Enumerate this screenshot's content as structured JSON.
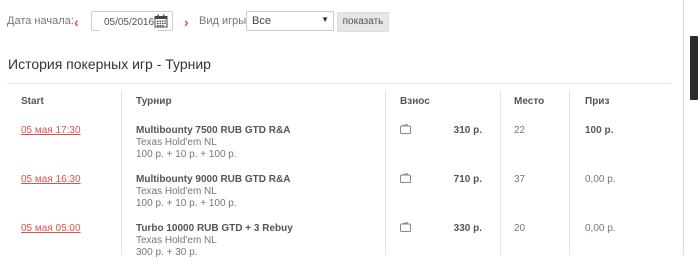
{
  "filters": {
    "start_date_label": "Дата начала:",
    "prev_symbol": "‹",
    "next_symbol": "›",
    "date_value": "05/05/2016",
    "game_type_label": "Вид игры:",
    "game_type_selected": "Все",
    "show_button": "показать"
  },
  "page": {
    "title": "История покерных игр - Турнир"
  },
  "table": {
    "headers": {
      "start": "Start",
      "tournament": "Турнир",
      "buyin": "Взнос",
      "place": "Место",
      "prize": "Приз"
    },
    "rows": [
      {
        "date": "05 мая 17:30",
        "name": "Multibounty 7500 RUB GTD R&A",
        "game": "Texas Hold'em NL",
        "fees": "100 р. + 10 р. + 100 р.",
        "buyin": "310 р.",
        "place": "22",
        "prize": "100 р."
      },
      {
        "date": "05 мая 16:30",
        "name": "Multibounty 9000 RUB GTD R&A",
        "game": "Texas Hold'em NL",
        "fees": "100 р. + 10 р. + 100 р.",
        "buyin": "710 р.",
        "place": "37",
        "prize": "0,00 р."
      },
      {
        "date": "05 мая 05:00",
        "name": "Turbo 10000 RUB GTD + 3 Rebuy",
        "game": "Texas Hold'em NL",
        "fees": "300 р. + 30 р.",
        "buyin": "330 р.",
        "place": "20",
        "prize": "0,00 р."
      }
    ]
  },
  "colors": {
    "accent": "#d9534f",
    "text": "#333333",
    "muted": "#777777"
  }
}
